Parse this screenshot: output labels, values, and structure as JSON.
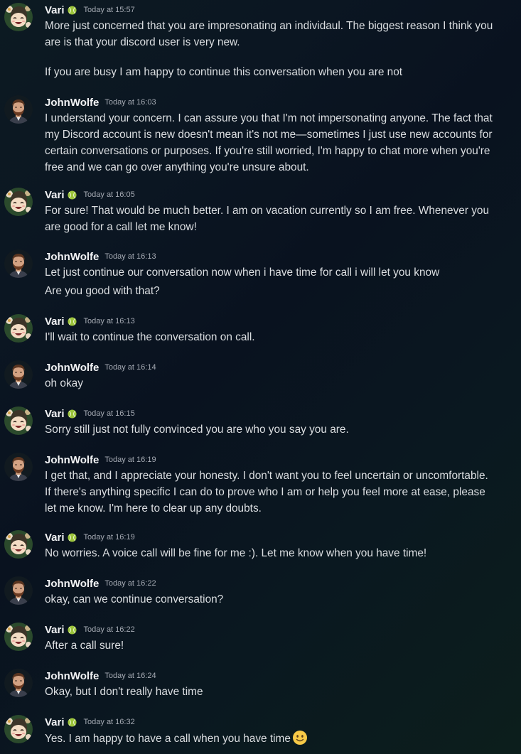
{
  "users": {
    "vari": {
      "name": "Vari",
      "badge_icon": "tennis-ball-icon",
      "accent": "#9cc43b"
    },
    "john": {
      "name": "JohnWolfe"
    }
  },
  "messages": [
    {
      "author": "Vari",
      "time": "Today at 15:57",
      "lines": [
        "More just concerned that you are impresonating an individaul. The biggest reason I think you",
        "are is that your discord user is very new.",
        "",
        "If you are busy I am happy to continue this conversation when you are not"
      ]
    },
    {
      "author": "JohnWolfe",
      "time": "Today at 16:03",
      "lines": [
        "I understand your concern. I can assure you that I'm not impersonating anyone. The fact that",
        "my Discord account is new doesn't mean it's not me—sometimes I just use new accounts for",
        "certain conversations or purposes. If you're still worried, I'm happy to chat more when you're",
        "free and we can go over anything you're unsure about."
      ]
    },
    {
      "author": "Vari",
      "time": "Today at 16:05",
      "lines": [
        "For sure! That would be much better. I am on vacation currently so I am free. Whenever you",
        "are good for a call let me know!"
      ]
    },
    {
      "author": "JohnWolfe",
      "time": "Today at 16:13",
      "lines": [
        "Let just continue our conversation now when i have time for call i will let you know"
      ],
      "followup": "Are you good with that?"
    },
    {
      "author": "Vari",
      "time": "Today at 16:13",
      "lines": [
        "I'll wait to continue the conversation on call."
      ]
    },
    {
      "author": "JohnWolfe",
      "time": "Today at 16:14",
      "lines": [
        "oh okay"
      ]
    },
    {
      "author": "Vari",
      "time": "Today at 16:15",
      "lines": [
        "Sorry still just not fully convinced you are who you say you are."
      ]
    },
    {
      "author": "JohnWolfe",
      "time": "Today at 16:19",
      "lines": [
        "I get that, and I appreciate your honesty. I don't want you to feel uncertain or uncomfortable.",
        "If there's anything specific I can do to prove who I am or help you feel more at ease, please",
        "let me know. I'm here to clear up any doubts."
      ]
    },
    {
      "author": "Vari",
      "time": "Today at 16:19",
      "lines": [
        "No worries. A voice call will be fine for me :). Let me know when you have time!"
      ]
    },
    {
      "author": "JohnWolfe",
      "time": "Today at 16:22",
      "lines": [
        "okay, can we continue conversation?"
      ]
    },
    {
      "author": "Vari",
      "time": "Today at 16:22",
      "lines": [
        "After a call sure!"
      ]
    },
    {
      "author": "JohnWolfe",
      "time": "Today at 16:24",
      "lines": [
        "Okay, but I don't really have time"
      ]
    },
    {
      "author": "Vari",
      "time": "Today at 16:32",
      "lines": [
        "Yes. I am happy to have a call when you have time"
      ],
      "emoji": "slightly-smiling-face-emoji"
    }
  ]
}
